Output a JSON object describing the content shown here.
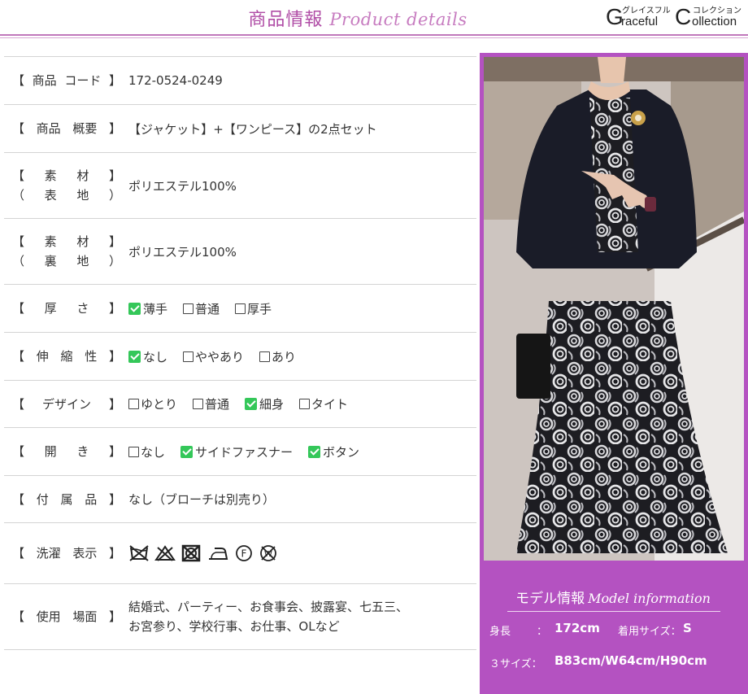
{
  "header": {
    "title_jp": "商品情報",
    "title_en": "Product details",
    "brand": {
      "g": "G",
      "kana1": "グレイスフル",
      "raceful": "raceful",
      "c": "C",
      "kana2": "コレクション",
      "ollection": "ollection"
    }
  },
  "specs": [
    {
      "label": [
        "【 商品 コード 】"
      ],
      "value": "172-0524-0249"
    },
    {
      "label": [
        "【 商品 概要 】"
      ],
      "value": "【ジャケット】+【ワンピース】の2点セット"
    },
    {
      "label": [
        "【 素 材 】",
        "（ 表 地 ）"
      ],
      "value": "ポリエステル100%"
    },
    {
      "label": [
        "【 素 材 】",
        "（ 裏 地 ）"
      ],
      "value": "ポリエステル100%"
    },
    {
      "label": [
        "【 厚 さ 】"
      ],
      "options": [
        {
          "text": "薄手",
          "checked": true
        },
        {
          "text": "普通",
          "checked": false
        },
        {
          "text": "厚手",
          "checked": false
        }
      ]
    },
    {
      "label": [
        "【 伸 縮 性 】"
      ],
      "options": [
        {
          "text": "なし",
          "checked": true
        },
        {
          "text": "ややあり",
          "checked": false
        },
        {
          "text": "あり",
          "checked": false
        }
      ]
    },
    {
      "label": [
        "【 デザイン 】"
      ],
      "options": [
        {
          "text": "ゆとり",
          "checked": false
        },
        {
          "text": "普通",
          "checked": false
        },
        {
          "text": "細身",
          "checked": true
        },
        {
          "text": "タイト",
          "checked": false
        }
      ]
    },
    {
      "label": [
        "【 開 き 】"
      ],
      "options": [
        {
          "text": "なし",
          "checked": false
        },
        {
          "text": "サイドファスナー",
          "checked": true
        },
        {
          "text": "ボタン",
          "checked": true
        }
      ]
    },
    {
      "label": [
        "【 付 属 品 】"
      ],
      "value": "なし（ブローチは別売り）"
    },
    {
      "label": [
        "【 洗濯 表示 】"
      ],
      "care_icons": [
        "no-washing-icon",
        "no-bleach-icon",
        "no-tumble-dry-icon",
        "no-ironing-icon",
        "dry-clean-f-icon",
        "no-wet-clean-icon"
      ]
    },
    {
      "label": [
        "【 使用 場面 】"
      ],
      "value_lines": [
        "結婚式、パーティー、お食事会、披露宴、七五三、",
        "お宮参り、学校行事、お仕事、OLなど"
      ]
    }
  ],
  "model": {
    "title_jp": "モデル情報",
    "title_en": "Model information",
    "height_label": "身長",
    "height_colon": "：",
    "height_value": "172cm",
    "size_label": "着用サイズ：",
    "size_value": "S",
    "three_size_label": "３サイズ：",
    "three_size_value": "B83cm/W64cm/H90cm"
  },
  "colors": {
    "accent": "#b452c1",
    "title": "#b04da6",
    "check": "#34c759"
  }
}
